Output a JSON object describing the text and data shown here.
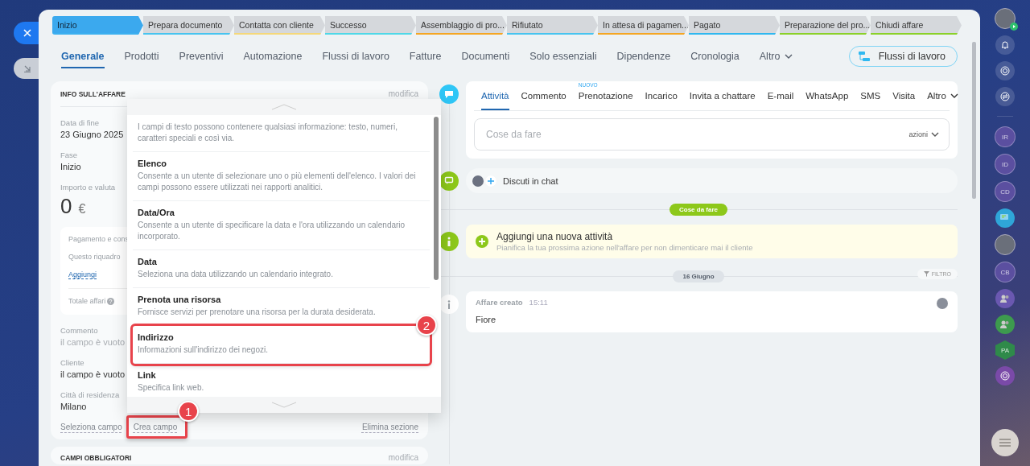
{
  "stages": [
    {
      "label": "Inizio",
      "selected": true,
      "color": "#3bb0f0"
    },
    {
      "label": "Prepara documento",
      "selected": false,
      "color": "#47c4f0"
    },
    {
      "label": "Contatta con cliente",
      "selected": false,
      "color": "#f5d87a"
    },
    {
      "label": "Successo",
      "selected": false,
      "color": "#4fd8e8"
    },
    {
      "label": "Assemblaggio di pro...",
      "selected": false,
      "color": "#f5a623"
    },
    {
      "label": "Rifiutato",
      "selected": false,
      "color": "#47c4f0"
    },
    {
      "label": "In attesa di pagamen...",
      "selected": false,
      "color": "#f5a623"
    },
    {
      "label": "Pagato",
      "selected": false,
      "color": "#2fb8f0"
    },
    {
      "label": "Preparazione del pro...",
      "selected": false,
      "color": "#8bd129"
    },
    {
      "label": "Chiudi affare",
      "selected": false,
      "color": "#8bd129"
    }
  ],
  "tabs": [
    {
      "label": "Generale",
      "selected": true,
      "dropdown": false
    },
    {
      "label": "Prodotti",
      "selected": false,
      "dropdown": false
    },
    {
      "label": "Preventivi",
      "selected": false,
      "dropdown": false
    },
    {
      "label": "Automazione",
      "selected": false,
      "dropdown": false
    },
    {
      "label": "Flussi di lavoro",
      "selected": false,
      "dropdown": false
    },
    {
      "label": "Fatture",
      "selected": false,
      "dropdown": false
    },
    {
      "label": "Documenti",
      "selected": false,
      "dropdown": false
    },
    {
      "label": "Solo essenziali",
      "selected": false,
      "dropdown": false
    },
    {
      "label": "Dipendenze",
      "selected": false,
      "dropdown": false
    },
    {
      "label": "Cronologia",
      "selected": false,
      "dropdown": false
    },
    {
      "label": "Altro",
      "selected": false,
      "dropdown": true
    }
  ],
  "workflows_button": "Flussi di lavoro",
  "deal_info": {
    "title": "INFO SULL'AFFARE",
    "edit": "modifica",
    "top_fields": [
      {
        "label": "Data di fine",
        "value": "23 Giugno 2025"
      },
      {
        "label": "Fase",
        "value": "Inizio"
      }
    ],
    "amount": {
      "label": "Importo e valuta",
      "value": "0",
      "currency": "€"
    },
    "payment": {
      "title": "Pagamento e cons",
      "note": "Questo riquadro",
      "add": "Aggiungi",
      "total": "Totale affari"
    },
    "fields": [
      {
        "label": "Commento",
        "value": "il campo è vuoto",
        "muted": true
      },
      {
        "label": "Cliente",
        "value": "il campo è vuoto",
        "muted": false
      },
      {
        "label": "Città di residenza",
        "value": "Milano",
        "muted": false
      }
    ],
    "actions": [
      {
        "label": "Seleziona campo",
        "highlighted": false
      },
      {
        "label": "Crea campo",
        "highlighted": true,
        "callout": "1"
      }
    ],
    "delete": "Elimina sezione"
  },
  "required_card": {
    "title": "CAMPI OBBLIGATORI",
    "edit": "modifica"
  },
  "field_types": [
    {
      "description": "I campi di testo possono contenere qualsiasi informazione: testo, numeri, caratteri speciali e così via.",
      "highlighted": false
    },
    {
      "title": "Elenco",
      "description": "Consente a un utente di selezionare uno o più elementi dell'elenco. I valori dei campi possono essere utilizzati nei rapporti analitici.",
      "highlighted": false
    },
    {
      "title": "Data/Ora",
      "description": "Consente a un utente di specificare la data e l'ora utilizzando un calendario incorporato.",
      "highlighted": false
    },
    {
      "title": "Data",
      "description": "Seleziona una data utilizzando un calendario integrato.",
      "highlighted": false
    },
    {
      "title": "Prenota una risorsa",
      "description": "Fornisce servizi per prenotare una risorsa per la durata desiderata.",
      "highlighted": false
    },
    {
      "title": "Indirizzo",
      "description": "Informazioni sull'indirizzo dei negozi.",
      "highlighted": true,
      "callout": "2"
    },
    {
      "title": "Link",
      "description": "Specifica link web.",
      "highlighted": false
    }
  ],
  "activity_tabs": [
    {
      "label": "Attività",
      "selected": true
    },
    {
      "label": "Commento",
      "selected": false
    },
    {
      "label": "Prenotazione",
      "selected": false,
      "badge": "NUOVO"
    },
    {
      "label": "Incarico",
      "selected": false
    },
    {
      "label": "Invita a chattare",
      "selected": false
    },
    {
      "label": "E-mail",
      "selected": false
    },
    {
      "label": "WhatsApp",
      "selected": false
    },
    {
      "label": "SMS",
      "selected": false
    },
    {
      "label": "Visita",
      "selected": false
    },
    {
      "label": "Altro",
      "selected": false,
      "dropdown": true
    }
  ],
  "todo_input": {
    "placeholder": "Cose da fare",
    "actions": "azioni"
  },
  "chat": "Discuti in chat",
  "todo_divider": "Cose da fare",
  "add_activity": {
    "title": "Aggiungi una nuova attività",
    "subtitle": "Pianifica la tua prossima azione nell'affare per non dimenticare mai il cliente"
  },
  "date_divider": "16 Giugno",
  "filter": "FILTRO",
  "event": {
    "title": "Affare creato",
    "time": "15:11",
    "text": "Fiore"
  },
  "right_sidebar": [
    {
      "kind": "avatar"
    },
    {
      "kind": "bell"
    },
    {
      "kind": "target"
    },
    {
      "kind": "exchange"
    },
    {
      "kind": "initials",
      "text": "IR",
      "color": "#5b4fa0"
    },
    {
      "kind": "initials",
      "text": "ID",
      "color": "#5b4fa0"
    },
    {
      "kind": "initials",
      "text": "CD",
      "color": "#5b4fa0"
    },
    {
      "kind": "chat",
      "color": "#2fa6d8"
    },
    {
      "kind": "avatar"
    },
    {
      "kind": "initials",
      "text": "CB",
      "color": "#5b4fa0"
    },
    {
      "kind": "group",
      "color": "#6a58b0"
    },
    {
      "kind": "group",
      "color": "#3d9a4e"
    },
    {
      "kind": "hexagon",
      "text": "PA",
      "color": "#2f8a4a"
    },
    {
      "kind": "target",
      "color": "#7a4aa8"
    }
  ]
}
